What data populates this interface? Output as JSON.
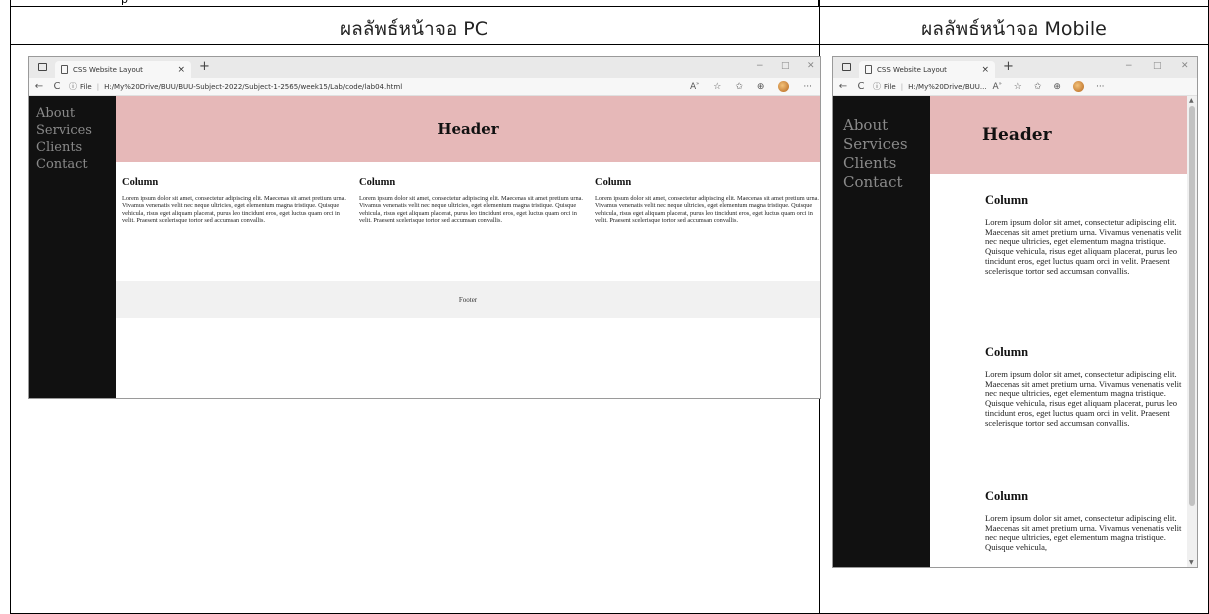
{
  "top_fragment": "p",
  "headers": {
    "pc": "ผลลัพธ์หน้าจอ PC",
    "mobile": "ผลลัพธ์หน้าจอ Mobile"
  },
  "browser": {
    "tab_title": "CSS Website Layout",
    "tab_close": "×",
    "new_tab": "+",
    "back": "←",
    "reload": "C",
    "info_icon": "ⓘ",
    "file_label": "File",
    "pc_url": "H:/My%20Drive/BUU/BUU-Subject-2022/Subject-1-2565/week15/Lab/code/lab04.html",
    "mobile_url": "H:/My%20Drive/BUU...",
    "minimize": "−",
    "maximize": "□",
    "close": "✕",
    "more": "···"
  },
  "site": {
    "nav": [
      "About",
      "Services",
      "Clients",
      "Contact"
    ],
    "header": "Header",
    "column_title": "Column",
    "column_text": "Lorem ipsum dolor sit amet, consectetur adipiscing elit. Maecenas sit amet pretium urna. Vivamus venenatis velit nec neque ultricies, eget elementum magna tristique. Quisque vehicula, risus eget aliquam placerat, purus leo tincidunt eros, eget luctus quam orci in velit. Praesent scelerisque tortor sed accumsan convallis.",
    "mobile_column_text_cut": "Lorem ipsum dolor sit amet, consectetur adipiscing elit. Maecenas sit amet pretium urna. Vivamus venenatis velit nec neque ultricies, eget elementum magna tristique. Quisque vehicula,",
    "footer": "Footer"
  }
}
